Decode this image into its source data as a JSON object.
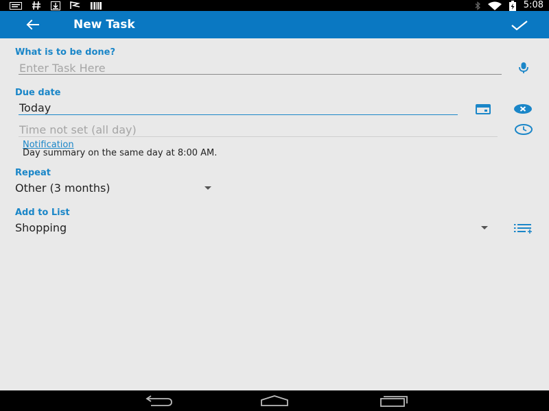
{
  "status_bar": {
    "time": "5:08",
    "left_icons": [
      "message-icon",
      "hash-icon",
      "download-icon",
      "flag-icon",
      "barcode-icon"
    ],
    "right_icons": [
      "bluetooth-icon",
      "wifi-icon",
      "battery-charging-icon"
    ]
  },
  "app_bar": {
    "title": "New Task",
    "accent_color": "#0a78c2"
  },
  "task": {
    "label": "What is to be done?",
    "placeholder": "Enter Task Here",
    "value": ""
  },
  "due_date": {
    "label": "Due date",
    "value": "Today",
    "time_placeholder": "Time not set (all day)",
    "notification_link": "Notification",
    "notification_desc": "Day summary on the same day at 8:00 AM."
  },
  "repeat": {
    "label": "Repeat",
    "value": "Other (3 months)"
  },
  "list": {
    "label": "Add to List",
    "value": "Shopping"
  },
  "nav_bar": {
    "buttons": [
      "back-nav-icon",
      "home-nav-icon",
      "recents-nav-icon"
    ]
  }
}
